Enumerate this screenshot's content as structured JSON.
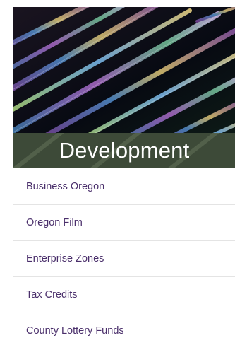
{
  "section": {
    "image_icon": "fiber-optic-banner-image",
    "title": "Development",
    "title_bg_color": "#3d4a38",
    "link_color": "#4a2f6b"
  },
  "menu": {
    "items": [
      {
        "label": "Business Oregon"
      },
      {
        "label": "Oregon Film"
      },
      {
        "label": "Enterprise Zones"
      },
      {
        "label": "Tax Credits"
      },
      {
        "label": "County Lottery Funds"
      }
    ]
  }
}
